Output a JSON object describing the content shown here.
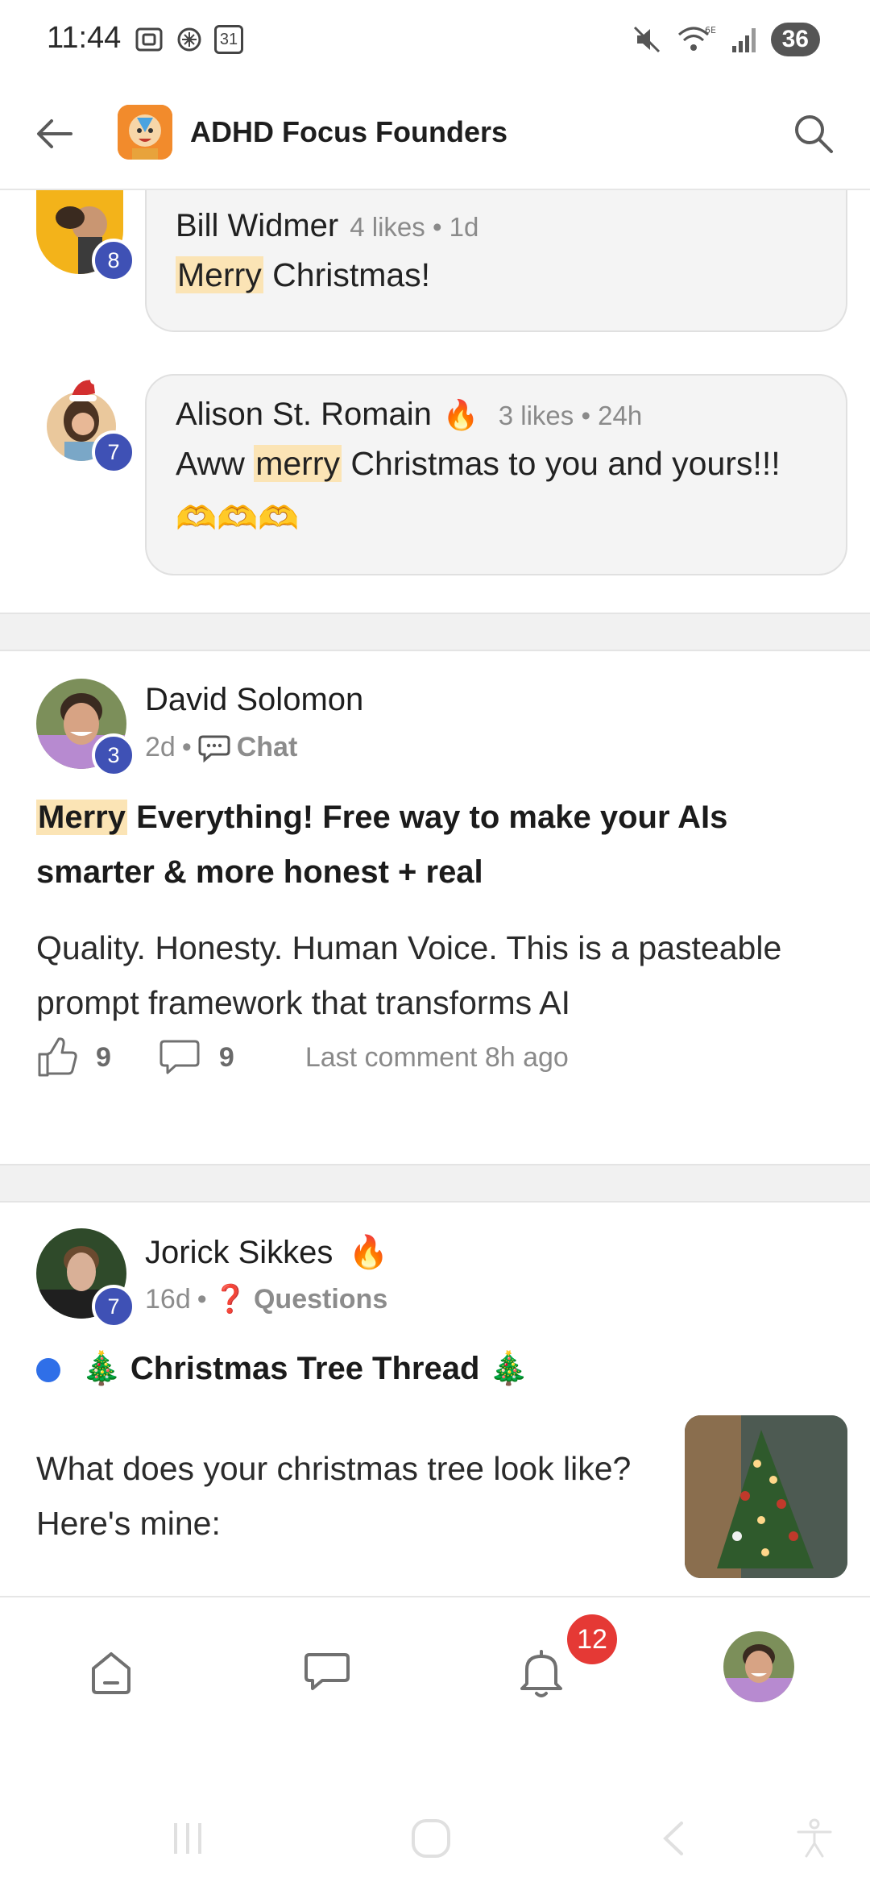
{
  "status_bar": {
    "time": "11:44",
    "battery": "36",
    "left_icons": [
      "screenshot-icon",
      "ai-assistant-icon",
      "calendar-icon"
    ],
    "calendar_day": "31",
    "right_icons": [
      "mute-icon",
      "wifi-6e-icon",
      "signal-icon"
    ]
  },
  "header": {
    "title": "ADHD Focus Founders",
    "back_icon": "back-arrow-icon",
    "search_icon": "search-icon"
  },
  "comments": [
    {
      "author": "Bill Widmer",
      "level": "8",
      "meta": "4 likes • 1d",
      "text_highlight": "Merry",
      "text_rest": " Christmas!"
    },
    {
      "author": "Alison St. Romain",
      "author_emoji": "🔥",
      "level": "7",
      "meta": "3 likes • 24h",
      "text_before": "Aww ",
      "text_highlight": "merry",
      "text_after": " Christmas to you and yours!!! 🫶🫶🫶"
    }
  ],
  "posts": [
    {
      "author": "David Solomon",
      "level": "3",
      "age": "2d",
      "category": "Chat",
      "category_icon": "chat-bubble-icon",
      "title_highlight": "Merry",
      "title_rest": " Everything! Free way to make your AIs smarter & more honest + real",
      "body": "Quality. Honesty. Human Voice. This is a pasteable prompt framework that transforms AI",
      "likes": "9",
      "comments": "9",
      "last_comment": "Last comment 8h ago"
    },
    {
      "author": "Jorick Sikkes",
      "author_emoji": "🔥",
      "level": "7",
      "age": "16d",
      "category": "Questions",
      "category_icon": "question-mark-icon",
      "category_glyph": "❓",
      "title": "🎄 Christmas Tree Thread 🎄",
      "body": "What does your christmas tree look like? Here's mine:",
      "unread": true
    }
  ],
  "bottom_nav": {
    "items": [
      "home-icon",
      "chat-icon",
      "notifications-icon",
      "profile-avatar"
    ],
    "notification_count": "12"
  },
  "system_nav": [
    "recents-icon",
    "home-icon",
    "back-icon",
    "accessibility-icon"
  ],
  "colors": {
    "level_badge": "#3f51b5",
    "highlight": "#fbe4b5",
    "notif_badge": "#e53935",
    "unread_dot": "#2f6fe8"
  }
}
